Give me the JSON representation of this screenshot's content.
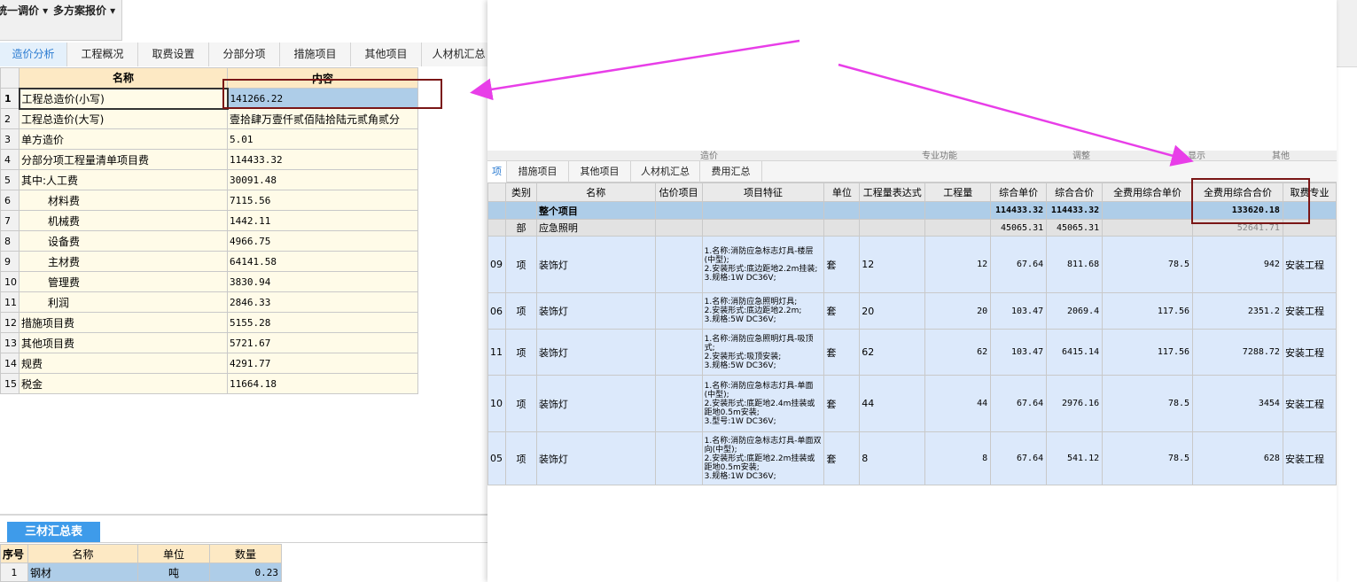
{
  "toolbar": {
    "menu1": "统一调价 ▾",
    "menu2": "多方案报价 ▾"
  },
  "tabs": [
    "造价分析",
    "工程概况",
    "取费设置",
    "分部分项",
    "措施项目",
    "其他项目",
    "人材机汇总"
  ],
  "grid": {
    "headers": [
      "名称",
      "内容"
    ],
    "rows": [
      {
        "idx": "1",
        "name": "工程总造价(小写)",
        "value": "141266.22"
      },
      {
        "idx": "2",
        "name": "工程总造价(大写)",
        "value": "壹拾肆万壹仟贰佰陆拾陆元贰角贰分"
      },
      {
        "idx": "3",
        "name": "单方造价",
        "value": "5.01"
      },
      {
        "idx": "4",
        "name": "分部分项工程量清单项目费",
        "value": "114433.32"
      },
      {
        "idx": "5",
        "name": "其中:人工费",
        "value": "30091.48"
      },
      {
        "idx": "6",
        "name": "材料费",
        "value": "7115.56"
      },
      {
        "idx": "7",
        "name": "机械费",
        "value": "1442.11"
      },
      {
        "idx": "8",
        "name": "设备费",
        "value": "4966.75"
      },
      {
        "idx": "9",
        "name": "主材费",
        "value": "64141.58"
      },
      {
        "idx": "10",
        "name": "管理费",
        "value": "3830.94"
      },
      {
        "idx": "11",
        "name": "利润",
        "value": "2846.33"
      },
      {
        "idx": "12",
        "name": "措施项目费",
        "value": "5155.28"
      },
      {
        "idx": "13",
        "name": "其他项目费",
        "value": "5721.67"
      },
      {
        "idx": "14",
        "name": "规费",
        "value": "4291.77"
      },
      {
        "idx": "15",
        "name": "税金",
        "value": "11664.18"
      }
    ]
  },
  "sancai": {
    "tab": "三材汇总表",
    "headers": [
      "序号",
      "名称",
      "单位",
      "数量"
    ],
    "rows": [
      {
        "idx": "1",
        "name": "钢材",
        "unit": "吨",
        "qty": "0.23"
      }
    ]
  },
  "panel": {
    "ribbon": [
      "造价",
      "专业功能",
      "调整",
      "显示",
      "其他"
    ],
    "tabs": [
      "项",
      "措施项目",
      "其他项目",
      "人材机汇总",
      "费用汇总"
    ],
    "headers": [
      "类别",
      "名称",
      "估价项目",
      "项目特征",
      "单位",
      "工程量表达式",
      "工程量",
      "综合单价",
      "综合合价",
      "全费用综合单价",
      "全费用综合合价",
      "取费专业"
    ],
    "whole": {
      "name": "整个项目",
      "hj": "114433.32",
      "hj2": "114433.32",
      "qf": "133620.18"
    },
    "bu": {
      "type": "部",
      "name": "应急照明",
      "dj": "45065.31",
      "hj": "45065.31",
      "qf": "52641.71"
    },
    "items": [
      {
        "code": "09",
        "type": "项",
        "name": "装饰灯",
        "feat": "1.名称:消防应急标志灯具-楼层(中型);\n2.安装形式:底边距地2.2m挂装;\n3.规格:1W   DC36V;",
        "unit": "套",
        "expr": "12",
        "qty": "12",
        "dj": "67.64",
        "hj": "811.68",
        "qfdj": "78.5",
        "qfhj": "942",
        "zy": "安装工程"
      },
      {
        "code": "06",
        "type": "项",
        "name": "装饰灯",
        "feat": "1.名称:消防应急照明灯具;\n2.安装形式:底边距地2.2m;\n3.规格:5W   DC36V;",
        "unit": "套",
        "expr": "20",
        "qty": "20",
        "dj": "103.47",
        "hj": "2069.4",
        "qfdj": "117.56",
        "qfhj": "2351.2",
        "zy": "安装工程"
      },
      {
        "code": "11",
        "type": "项",
        "name": "装饰灯",
        "feat": "1.名称:消防应急照明灯具-吸顶式;\n2.安装形式:吸顶安装;\n3.规格:5W   DC36V;",
        "unit": "套",
        "expr": "62",
        "qty": "62",
        "dj": "103.47",
        "hj": "6415.14",
        "qfdj": "117.56",
        "qfhj": "7288.72",
        "zy": "安装工程"
      },
      {
        "code": "10",
        "type": "项",
        "name": "装饰灯",
        "feat": "1.名称:消防应急标志灯具-单面(中型);\n2.安装形式:底距地2.4m挂装或距地0.5m安装;\n3.型号:1W   DC36V;",
        "unit": "套",
        "expr": "44",
        "qty": "44",
        "dj": "67.64",
        "hj": "2976.16",
        "qfdj": "78.5",
        "qfhj": "3454",
        "zy": "安装工程"
      },
      {
        "code": "05",
        "type": "项",
        "name": "装饰灯",
        "feat": "1.名称:消防应急标志灯具-单面双向(中型);\n2.安装形式:底距地2.2m挂装或距地0.5m安装;\n3.规格:1W   DC36V;",
        "unit": "套",
        "expr": "8",
        "qty": "8",
        "dj": "67.64",
        "hj": "541.12",
        "qfdj": "78.5",
        "qfhj": "628",
        "zy": "安装工程"
      }
    ]
  },
  "colors": {
    "accent": "#3e9bea",
    "selection": "#aecde8",
    "header": "#fde9c4",
    "annotation_box": "#7a1616",
    "annotation_arrow": "#e83ee8"
  }
}
